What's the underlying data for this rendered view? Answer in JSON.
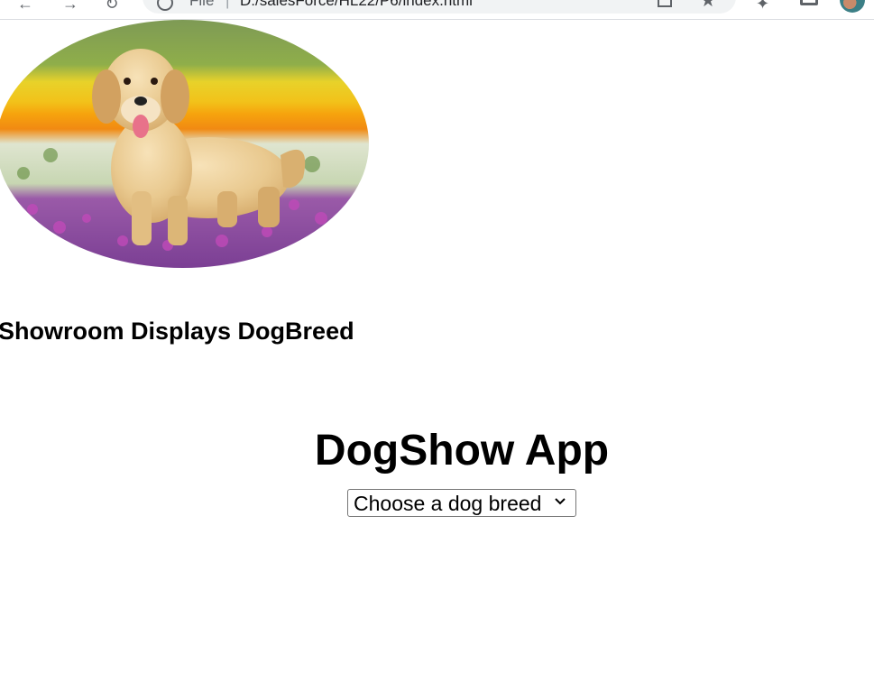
{
  "browser": {
    "url_scheme": "File",
    "url_separator": "|",
    "url": "D:/salesForce/HL22/P6/index.html",
    "icons": [
      "back-arrow-icon",
      "forward-arrow-icon",
      "reload-icon",
      "info-icon",
      "share-icon",
      "star-icon",
      "extensions-icon",
      "tab-icon",
      "profile-avatar"
    ]
  },
  "page": {
    "dog_image": {
      "description": "golden-retriever-in-flower-field",
      "shape": "oval"
    },
    "showroom_heading": "Showroom Displays DogBreed",
    "app_title": "DogShow App",
    "breed_select": {
      "selected": "Choose a dog breed",
      "options": [
        "Choose a dog breed"
      ]
    }
  },
  "colors": {
    "background": "#ffffff",
    "text": "#000000",
    "chrome_bar": "#f1f3f4"
  }
}
